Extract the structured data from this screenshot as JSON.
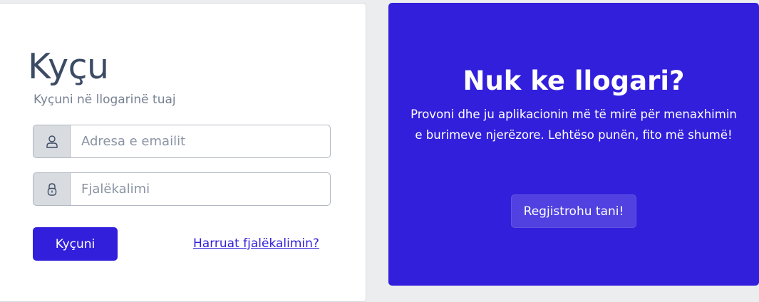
{
  "login": {
    "title": "Kyçu",
    "subtitle": "Kyçuni në llogarinë tuaj",
    "email": {
      "placeholder": "Adresa e emailit",
      "value": "",
      "icon": "user-icon"
    },
    "password": {
      "placeholder": "Fjalëkalimi",
      "value": "",
      "icon": "lock-icon"
    },
    "submit_label": "Kyçuni",
    "forgot_label": "Harruat fjalëkalimin?"
  },
  "register": {
    "title": "Nuk ke llogari?",
    "text": "Provoni dhe ju aplikacionin më të mirë për menaxhimin e burimeve njerëzore. Lehtëso punën, fito më shumë!",
    "button_label": "Regjistrohu tani!"
  },
  "colors": {
    "primary": "#321fdb",
    "background": "#ebedef",
    "text": "#3c4b64",
    "muted": "#768192"
  }
}
